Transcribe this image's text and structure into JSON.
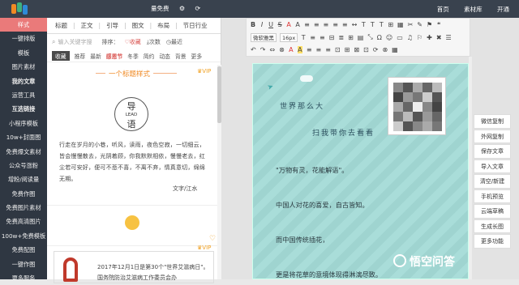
{
  "topbar": {
    "center_text": "量免费",
    "nav": [
      "首页",
      "素材库",
      "开通"
    ]
  },
  "sidebar": {
    "items": [
      "样式",
      "一键排版",
      "模板",
      "图片素材",
      "我的文章",
      "运营工具",
      "互选链接",
      "小程序模板",
      "10w+封面图",
      "免费爆文素材",
      "公众号涨粉",
      "增粉/阅读量",
      "免费作图",
      "免费图片素材",
      "免费高清图片",
      "100w+免费模板",
      "免费配图",
      "一键作图",
      "更多服务"
    ]
  },
  "panel": {
    "tabs": [
      "标题",
      "正文",
      "引导",
      "图文",
      "布局",
      "节日行业"
    ],
    "search_placeholder": "输入关键字搜",
    "sort_label": "排序：",
    "sort_options": [
      "收藏",
      "次数",
      "最近"
    ],
    "cats": [
      "收藏",
      "推荐",
      "最新",
      "感恩节",
      "冬季",
      "简约",
      "动态",
      "背景",
      "更多"
    ],
    "card1": {
      "title": "一个标题样式",
      "vip": "VIP",
      "circle_top": "导",
      "circle_mid": "LEAD",
      "circle_bottom": "语",
      "poem": "行走在岁月的小巷，听风，读雨，夜色空寂，一切细云，皆会慢慢散去，光阴着顾，你我默默相依，慢慢老去，红尘若可安好，便可不悲不喜，不离不弃，情真意切，绵绵无期。",
      "author": "文字/江水"
    },
    "card3": {
      "vip": "VIP",
      "news": "2017年12月1日是第30个\"世界艾滋病日\"。国务院防治艾滋病工作委员会办"
    }
  },
  "toolbar": {
    "row1": [
      "B",
      "I",
      "U",
      "S",
      "A",
      "A",
      "≡",
      "≡",
      "≡",
      "≡",
      "≡",
      "↔",
      "T",
      "T",
      "T",
      "⊞",
      "▦",
      "✂",
      "✎",
      "⚑",
      "❝",
      "…",
      "⊕",
      "⊗"
    ],
    "font_select": "微软雅黑",
    "size_select": "16px",
    "row2": [
      "T",
      "≡",
      "≡",
      "⊟",
      "≣",
      "⊞",
      "▤",
      "⤡",
      "Ω",
      "☺",
      "▭",
      "♫",
      "⚐",
      "✚",
      "✖",
      "☰"
    ],
    "row3": [
      "↶",
      "↷",
      "⇔",
      "⊗",
      "A",
      "A",
      "≡",
      "≡",
      "≡",
      "⊡",
      "⊞",
      "⊠",
      "⊡",
      "⟳",
      "⊗",
      "▦"
    ]
  },
  "canvas": {
    "handwriting_1": "世界那么大",
    "handwriting_2": "扫我带你去看看",
    "lines": [
      "\"万物有灵，花能解语\"。",
      "中国人对花的喜爱，自古皆知。",
      "而中国传统插花，",
      "更是将花草的意境体现得淋漓尽致。"
    ]
  },
  "actions": [
    "微信复制",
    "外网复制",
    "保存文章",
    "导入文章",
    "清空/新建",
    "手机预览",
    "云端草稿",
    "生成长图",
    "更多功能"
  ],
  "watermark": "悟空问答",
  "colors": {
    "topbar": "#39424e",
    "sidebar": "#2f3742",
    "active": "#ea7a7a",
    "accent": "#f08a24"
  }
}
